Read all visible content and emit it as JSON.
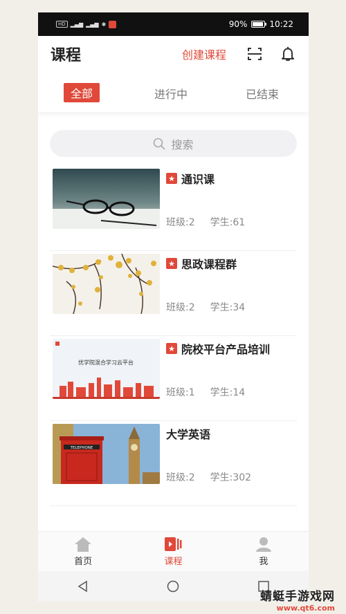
{
  "status_bar": {
    "network": "HD",
    "battery": "90%",
    "battery_level": 0.9,
    "time": "10:22"
  },
  "header": {
    "title": "课程",
    "create_label": "创建课程"
  },
  "tabs": [
    {
      "label": "全部",
      "active": true
    },
    {
      "label": "进行中",
      "active": false
    },
    {
      "label": "已结束",
      "active": false
    }
  ],
  "search": {
    "placeholder": "搜索"
  },
  "courses": [
    {
      "title": "通识课",
      "starred": true,
      "classes": "班级:2",
      "students": "学生:61"
    },
    {
      "title": "思政课程群",
      "starred": true,
      "classes": "班级:2",
      "students": "学生:34"
    },
    {
      "title": "院校平台产品培训",
      "starred": true,
      "classes": "班级:1",
      "students": "学生:14",
      "thumb_text": "优学院混合学习云平台"
    },
    {
      "title": "大学英语",
      "starred": false,
      "classes": "班级:2",
      "students": "学生:302",
      "thumb_text": "TELEPHONE"
    }
  ],
  "bottom_nav": [
    {
      "label": "首页",
      "icon": "home-icon",
      "active": false
    },
    {
      "label": "课程",
      "icon": "course-icon",
      "active": true
    },
    {
      "label": "我",
      "icon": "profile-icon",
      "active": false
    }
  ],
  "watermark": {
    "text": "蜻蜓手游戏网",
    "url": "www.qt6.com"
  },
  "colors": {
    "accent": "#e0493a",
    "text": "#222222",
    "muted": "#888888"
  }
}
